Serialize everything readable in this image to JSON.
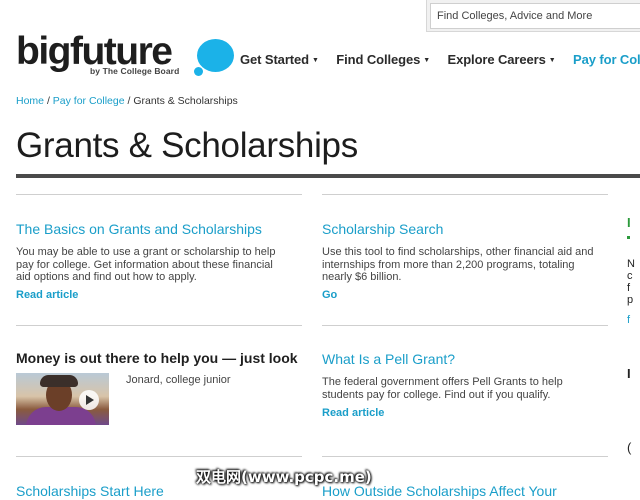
{
  "header": {
    "logo_text": "bigfuture",
    "logo_sub": "by The College Board",
    "search_placeholder": "Find Colleges, Advice and More",
    "nav": [
      {
        "label": "Get Started"
      },
      {
        "label": "Find Colleges"
      },
      {
        "label": "Explore Careers"
      },
      {
        "label": "Pay for Colleg"
      }
    ],
    "accent_color": "#1a9ec9",
    "logo_bubble_color": "#1bb2e8"
  },
  "breadcrumb": {
    "home": "Home",
    "pay": "Pay for College",
    "current": "/ Grants & Scholarships"
  },
  "page_title": "Grants & Scholarships",
  "cards": {
    "basics": {
      "title": "The Basics on Grants and Scholarships",
      "text": "You may be able to use a grant or scholarship to help pay for college. Get information about these financial aid options and find out how to apply.",
      "link": "Read article"
    },
    "search": {
      "title": "Scholarship Search",
      "text": "Use this tool to find scholarships, other financial aid and internships from more than 2,200 programs, totaling nearly $6 billion.",
      "link": "Go"
    },
    "money": {
      "title": "Money is out there to help you — just look",
      "author": "Jonard, college junior",
      "video_icon": "play-icon"
    },
    "pell": {
      "title": "What Is a Pell Grant?",
      "text": "The federal government offers Pell Grants to help students pay for college. Find out if you qualify.",
      "link": "Read article"
    },
    "start": {
      "title": "Scholarships Start Here"
    },
    "outside": {
      "title": "How Outside Scholarships Affect Your"
    }
  },
  "side_fragments": [
    "I",
    "N",
    "c",
    "f",
    "p",
    "f",
    "I",
    "("
  ],
  "watermark": "双电网(www.pcpc.me)"
}
